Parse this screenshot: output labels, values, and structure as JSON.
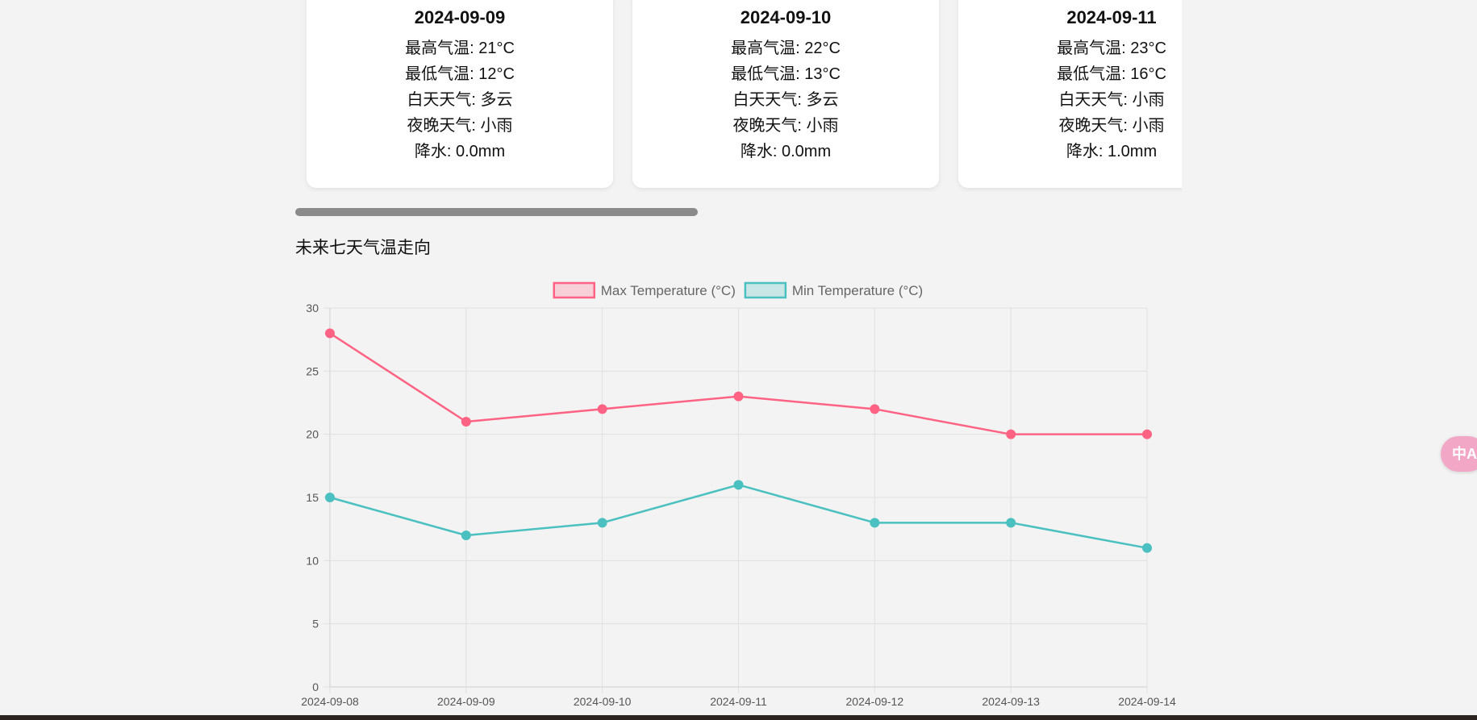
{
  "forecast_cards": [
    {
      "date": "2024-09-09",
      "max_temp": "最高气温: 21°C",
      "min_temp": "最低气温: 12°C",
      "day_weather": "白天天气: 多云",
      "night_weather": "夜晚天气: 小雨",
      "precip": "降水: 0.0mm"
    },
    {
      "date": "2024-09-10",
      "max_temp": "最高气温: 22°C",
      "min_temp": "最低气温: 13°C",
      "day_weather": "白天天气: 多云",
      "night_weather": "夜晚天气: 小雨",
      "precip": "降水: 0.0mm"
    },
    {
      "date": "2024-09-11",
      "max_temp": "最高气温: 23°C",
      "min_temp": "最低气温: 16°C",
      "day_weather": "白天天气: 小雨",
      "night_weather": "夜晚天气: 小雨",
      "precip": "降水: 1.0mm"
    }
  ],
  "section_title": "未来七天气温走向",
  "translate_button": {
    "label": "中A",
    "icon": "translate-icon"
  },
  "colors": {
    "max_series": "#ff6384",
    "min_series": "#4bc0c0",
    "grid": "#e0e0e0",
    "card_bg": "#ffffff",
    "page_bg": "#f3f3f3",
    "scrollbar_thumb": "#8a8a8a",
    "translate_button": "#f3a7c6"
  },
  "chart_data": {
    "type": "line",
    "categories": [
      "2024-09-08",
      "2024-09-09",
      "2024-09-10",
      "2024-09-11",
      "2024-09-12",
      "2024-09-13",
      "2024-09-14"
    ],
    "series": [
      {
        "name": "Max Temperature (°C)",
        "values": [
          28,
          21,
          22,
          23,
          22,
          20,
          20
        ],
        "color": "#ff6384"
      },
      {
        "name": "Min Temperature (°C)",
        "values": [
          15,
          12,
          13,
          16,
          13,
          13,
          11
        ],
        "color": "#4bc0c0"
      }
    ],
    "ylim": [
      0,
      30
    ],
    "yticks": [
      0,
      5,
      10,
      15,
      20,
      25,
      30
    ],
    "grid": true,
    "legend_position": "top"
  }
}
